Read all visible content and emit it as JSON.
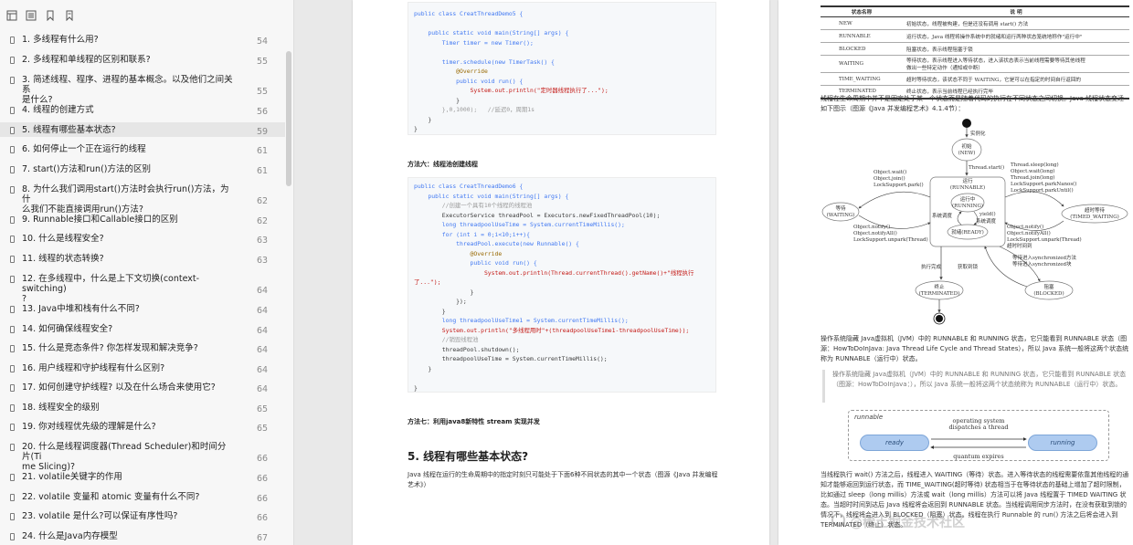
{
  "sidebar": {
    "toolbar_icons": [
      "thumbnails-icon",
      "outline-icon",
      "bookmark-icon",
      "bookmark-add-icon"
    ],
    "items": [
      {
        "label": "1.  多线程有什么用?",
        "page": "54"
      },
      {
        "label": "2.  多线程和单线程的区别和联系?",
        "page": "55"
      },
      {
        "label": "3.  简述线程、程序、进程的基本概念。以及他们之间关系\n是什么?",
        "page": "55"
      },
      {
        "label": "4.  线程的创建方式",
        "page": "56"
      },
      {
        "label": "5.  线程有哪些基本状态?",
        "page": "59"
      },
      {
        "label": "6.  如何停止一个正在运行的线程",
        "page": "61"
      },
      {
        "label": "7.  start()方法和run()方法的区别",
        "page": "61"
      },
      {
        "label": "8.  为什么我们调用start()方法时会执行run()方法，为什\n么我们不能直接调用run()方法?",
        "page": "62"
      },
      {
        "label": "9.  Runnable接口和Callable接口的区别",
        "page": "62"
      },
      {
        "label": "10.  什么是线程安全?",
        "page": "63"
      },
      {
        "label": "11.  线程的状态转换?",
        "page": "63"
      },
      {
        "label": "12.  在多线程中，什么是上下文切换(context-switching)\n?",
        "page": "64"
      },
      {
        "label": "13.  Java中堆和栈有什么不同?",
        "page": "64"
      },
      {
        "label": "14.  如何确保线程安全?",
        "page": "64"
      },
      {
        "label": "15.  什么是竞态条件? 你怎样发现和解决竞争?",
        "page": "64"
      },
      {
        "label": "16.  用户线程和守护线程有什么区别?",
        "page": "64"
      },
      {
        "label": "17.  如何创建守护线程? 以及在什么场合来使用它?",
        "page": "64"
      },
      {
        "label": "18.  线程安全的级别",
        "page": "65"
      },
      {
        "label": "19.  你对线程优先级的理解是什么?",
        "page": "65"
      },
      {
        "label": "20.  什么是线程调度器(Thread Scheduler)和时间分片(Ti\nme Slicing)?",
        "page": "66"
      },
      {
        "label": "21.  volatile关键字的作用",
        "page": "66"
      },
      {
        "label": "22.  volatile 变量和 atomic 变量有什么不同?",
        "page": "66"
      },
      {
        "label": "23.  volatile 是什么?可以保证有序性吗?",
        "page": "66"
      },
      {
        "label": "24.  什么是Java内存模型",
        "page": "67"
      }
    ]
  },
  "page1": {
    "code1": [
      "public class CreatThreadDemo5 {",
      "",
      "    public static void main(String[] args) {",
      "        Timer timer = new Timer();",
      "",
      "        timer.schedule(new TimerTask() {",
      "            @Override",
      "            public void run() {",
      "                System.out.println(\"定时器线程执行了...\");",
      "            }",
      "        },0,1000);   //延迟0，周期1s",
      "    }",
      "}"
    ],
    "method6_label": "方法六：线程池创建线程",
    "code2": [
      "public class CreatThreadDemo6 {",
      "    public static void main(String[] args) {",
      "        //创建一个具有10个线程的线程池",
      "        ExecutorService threadPool = Executors.newFixedThreadPool(10);",
      "        long threadpoolUseTime = System.currentTimeMillis();",
      "        for (int i = 0;i<10;i++){",
      "            threadPool.execute(new Runnable() {",
      "                @Override",
      "                public void run() {",
      "                    System.out.println(Thread.currentThread().getName()+\"线程执行",
      "了...\");",
      "                }",
      "            });",
      "        }",
      "        long threadpoolUseTime1 = System.currentTimeMillis();",
      "        System.out.println(\"多线程用时\"+(threadpoolUseTime1-threadpoolUseTime));",
      "        //销毁线程池",
      "        threadPool.shutdown();",
      "        threadpoolUseTime = System.currentTimeMillis();",
      "    }",
      "",
      "}"
    ],
    "method7_label": "方法七：利用java8新特性 stream 实现并发",
    "section_title": "5. 线程有哪些基本状态?",
    "section_body": "Java 线程在运行的生命周期中的指定时刻只可能处于下面6种不同状态的其中一个状态（图源《Java 并发编程艺术》）"
  },
  "page2": {
    "table_headers": [
      "状态名称",
      "说    明"
    ],
    "table_rows": [
      [
        "NEW",
        "初始状态，线程被构建，但是还没有调用 start() 方法"
      ],
      [
        "RUNNABLE",
        "运行状态，Java 线程将操作系统中的就绪和运行两种状态笼统地称作\"运行中\""
      ],
      [
        "BLOCKED",
        "阻塞状态，表示线程阻塞于锁"
      ],
      [
        "WAITING",
        "等待状态，表示线程进入等待状态，进入该状态表示当前线程需要等待其他线程\n做出一些特定动作（通知或中断）"
      ],
      [
        "TIME_WAITING",
        "超时等待状态，该状态不同于 WAITING，它是可以在指定的时间自行返回的"
      ],
      [
        "TERMINATED",
        "终止状态，表示当前线程已经执行完毕"
      ]
    ],
    "para1": "线程在生命周期中并不是固定处于某一个状态而是随着代码的执行在不同状态之间切换。Java 线程状态变迁如下图示（图源《Java 并发编程艺术》4.1.4节）：",
    "diagram": {
      "init_label": "实例化",
      "new_label": "初始\n(NEW)",
      "start_label": "Thread.start()",
      "runnable_outer": "运行\n(RUNNABLE)",
      "running_label": "运行中\n(RUNNING)",
      "ready_label": "就绪(READY)",
      "yield_label": "yield()",
      "sched_label": "系统调度",
      "sched_label2": "系统调度",
      "waiting_label": "等待\n(WAITING)",
      "timed_label": "超时等待\n(TIMED_WAITING)",
      "blocked_label": "阻塞\n(BLOCKED)",
      "terminated_label": "终止\n(TERMINATED)",
      "wait_calls": "Object.wait()\nObject.join()\nLockSupport.park()",
      "notify_calls": "Object.notify()\nObject.notifyAll()\nLockSupport.unpark(Thread)",
      "timed_calls": "Thread.sleep(long)\nObject.wait(long)\nThread.join(long)\nLockSupport.parkNanos()\nLockSupport.parkUntil()",
      "timed_notify": "Object.notify()\nObject.notifyAll()\nLockSupport.unpark(Thread)\n超时时间到",
      "sync_wait": "等待进入synchronized方法\n等待进入synchronized块",
      "exec_done": "执行完成",
      "get_lock": "获取到锁"
    },
    "para2": "操作系统隐藏 Java虚拟机（JVM）中的 RUNNABLE 和 RUNNING 状态，它只能看到 RUNNABLE 状态（图源：HowToDoInJava: Java Thread Life Cycle and Thread States），所以 Java 系统一般将这两个状态统称为 RUNNABLE（运行中）状态。",
    "quote": "操作系统隐藏 Java虚拟机（JVM）中的 RUNNABLE 和 RUNNING 状态，它只能看到 RUNNABLE 状态（图源：HowToDoInJava：），所以 Java 系统一般将这两个状态统称为 RUNNABLE（运行中）状态。",
    "rn": {
      "runnable": "runnable",
      "ready": "ready",
      "running": "running",
      "dispatch": "operating system\ndispatches a thread",
      "expires": "quantum expires"
    },
    "para3": "当线程执行 wait() 方法之后，线程进入 WAITING（等待）状态。进入等待状态的线程需要依靠其他线程的通知才能够返回到运行状态，而 TIME_WAITING(超时等待) 状态相当于在等待状态的基础上增加了超时限制，比如通过 sleep（long millis）方法或 wait（long millis）方法可以将 Java 线程置于 TIMED WAITING 状态。当超时时间到达后 Java 线程将会返回到 RUNNABLE 状态。当线程调用同步方法时，在没有获取到锁的情况下，线程将会进入到 BLOCKED（阻塞）状态。线程在执行 Runnable 的 run() 方法之后将会进入到 TERMINATED（终止）状态。",
    "watermark": "@稀土掘金技术社区"
  }
}
